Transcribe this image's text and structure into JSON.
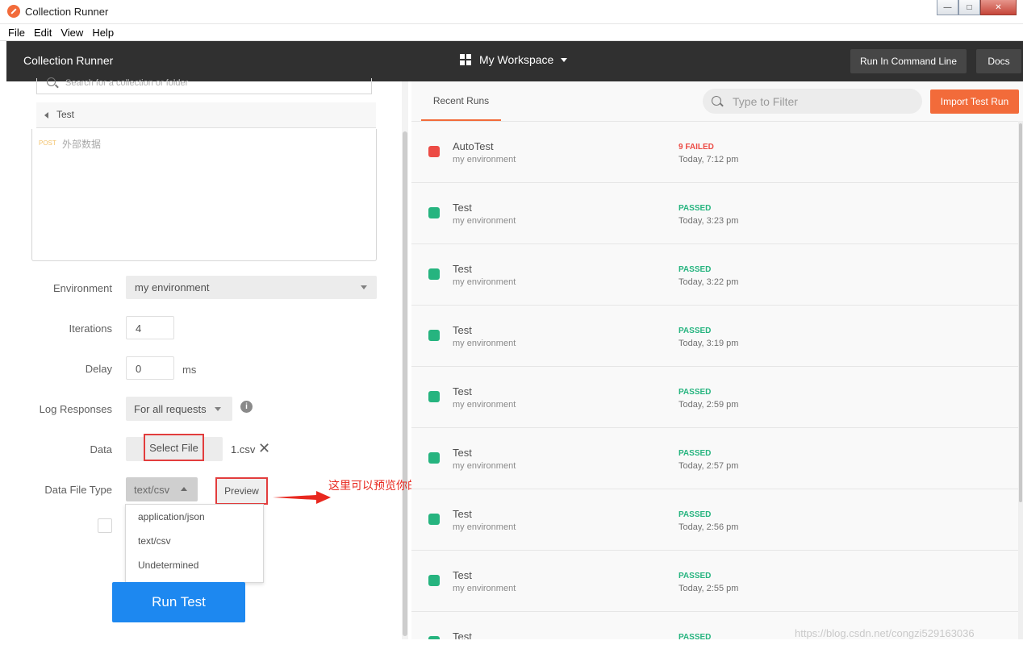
{
  "window": {
    "title": "Collection Runner"
  },
  "menu": [
    "File",
    "Edit",
    "View",
    "Help"
  ],
  "header": {
    "title": "Collection Runner",
    "workspace": "My Workspace",
    "run_cli": "Run In Command Line",
    "docs": "Docs"
  },
  "left": {
    "search_placeholder": "Search for a collection or folder",
    "breadcrumb": "Test",
    "request": {
      "method": "POST",
      "name": "外部数据"
    },
    "labels": {
      "environment": "Environment",
      "iterations": "Iterations",
      "delay": "Delay",
      "log_responses": "Log Responses",
      "data": "Data",
      "data_file_type": "Data File Type"
    },
    "environment_value": "my environment",
    "iterations_value": "4",
    "delay_value": "0",
    "delay_unit": "ms",
    "log_responses_value": "For all requests",
    "select_file": "Select File",
    "file_name": "1.csv",
    "data_file_type_value": "text/csv",
    "preview": "Preview",
    "dropdown_options": [
      "application/json",
      "text/csv",
      "Undetermined"
    ],
    "run_button": "Run Test",
    "annotation": "这里可以预览你的文件内容"
  },
  "right": {
    "tab": "Recent Runs",
    "filter_placeholder": "Type to Filter",
    "import_button": "Import Test Run",
    "runs": [
      {
        "name": "AutoTest",
        "env": "my environment",
        "status": "9 FAILED",
        "time": "Today, 7:12 pm",
        "color": "#ec4b45"
      },
      {
        "name": "Test",
        "env": "my environment",
        "status": "PASSED",
        "time": "Today, 3:23 pm",
        "color": "#26b47f"
      },
      {
        "name": "Test",
        "env": "my environment",
        "status": "PASSED",
        "time": "Today, 3:22 pm",
        "color": "#26b47f"
      },
      {
        "name": "Test",
        "env": "my environment",
        "status": "PASSED",
        "time": "Today, 3:19 pm",
        "color": "#26b47f"
      },
      {
        "name": "Test",
        "env": "my environment",
        "status": "PASSED",
        "time": "Today, 2:59 pm",
        "color": "#26b47f"
      },
      {
        "name": "Test",
        "env": "my environment",
        "status": "PASSED",
        "time": "Today, 2:57 pm",
        "color": "#26b47f"
      },
      {
        "name": "Test",
        "env": "my environment",
        "status": "PASSED",
        "time": "Today, 2:56 pm",
        "color": "#26b47f"
      },
      {
        "name": "Test",
        "env": "my environment",
        "status": "PASSED",
        "time": "Today, 2:55 pm",
        "color": "#26b47f"
      },
      {
        "name": "Test",
        "env": "",
        "status": "PASSED",
        "time": "",
        "color": "#26b47f"
      }
    ]
  },
  "watermark": "https://blog.csdn.net/congzi529163036"
}
